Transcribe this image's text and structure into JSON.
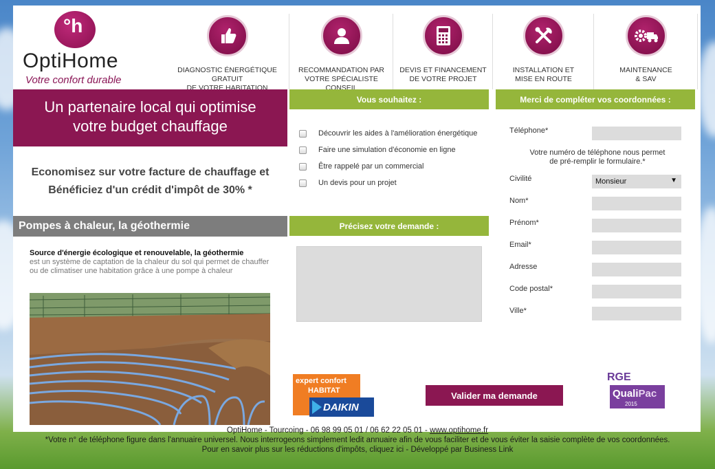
{
  "brand": {
    "name": "OptiHome",
    "tagline": "Votre confort durable",
    "mark_letters": "°h",
    "color": "#8b1752",
    "accent": "#95b63b"
  },
  "steps": [
    {
      "icon": "thumbs-up-icon",
      "label_1": "DIAGNOSTIC ÉNERGÉTIQUE GRATUIT",
      "label_2": "DE VOTRE HABITATION"
    },
    {
      "icon": "person-icon",
      "label_1": "RECOMMANDATION PAR",
      "label_2": "VOTRE SPÉCIALISTE CONSEIL"
    },
    {
      "icon": "calculator-icon",
      "label_1": "DEVIS ET FINANCEMENT",
      "label_2": "DE VOTRE PROJET"
    },
    {
      "icon": "tools-icon",
      "label_1": "INSTALLATION ET",
      "label_2": "MISE EN ROUTE"
    },
    {
      "icon": "gear-truck-icon",
      "label_1": "MAINTENANCE",
      "label_2": "& SAV"
    }
  ],
  "hero": {
    "line_1": "Un partenaire local qui optimise",
    "line_2": "votre budget chauffage"
  },
  "promo": {
    "line_1": "Economisez sur votre facture de chauffage et",
    "line_2": "Bénéficiez d'un crédit d'impôt de 30% *"
  },
  "section": {
    "title": "Pompes à chaleur, la géothermie",
    "desc_bold": "Source d'énergie écologique et renouvelable, la géothermie",
    "desc_rest": "est un système de captation de la chaleur du sol qui permet de chauffer ou de climatiser une habitation grâce à une pompe à chaleur"
  },
  "wishes": {
    "title": "Vous souhaitez :",
    "options": [
      "Découvrir les aides à l'amélioration énergétique",
      "Faire une simulation d'économie en ligne",
      "Être rappelé par un commercial",
      "Un devis pour un projet"
    ]
  },
  "request": {
    "title": "Précisez votre demande :",
    "value": ""
  },
  "contact": {
    "title": "Merci de compléter vos coordonnées :",
    "phone_label": "Téléphone*",
    "phone_note_1": "Votre numéro de téléphone nous permet",
    "phone_note_2": "de pré-remplir le formulaire.*",
    "civility_label": "Civilité",
    "civility_value": "Monsieur",
    "fields": [
      {
        "label": "Nom*",
        "value": ""
      },
      {
        "label": "Prénom*",
        "value": ""
      },
      {
        "label": "Email*",
        "value": ""
      },
      {
        "label": "Adresse",
        "value": ""
      },
      {
        "label": "Code postal*",
        "value": ""
      },
      {
        "label": "Ville*",
        "value": ""
      }
    ]
  },
  "submit_label": "Valider ma demande",
  "badges": {
    "daikin_line_1": "expert confort",
    "daikin_line_2": "HABITAT",
    "daikin_brand": "DAIKIN",
    "rge_top": "RGE",
    "rge_name_1": "Quali",
    "rge_name_2": "Pac",
    "rge_year": "2015"
  },
  "footer": {
    "line_1": "OptiHome - Tourcoing - 06 98 99 05 01 / 06 62 22 05 01 - ",
    "link": "www.optihome.fr",
    "line_2": "*Votre n° de téléphone figure dans l'annuaire universel. Nous interrogeons simplement ledit annuaire afin de vous faciliter et de vous éviter la saisie complète de vos coordonnées.",
    "line_3": "Pour en savoir plus sur les réductions d'impôts, cliquez ici - Développé par Business Link"
  }
}
